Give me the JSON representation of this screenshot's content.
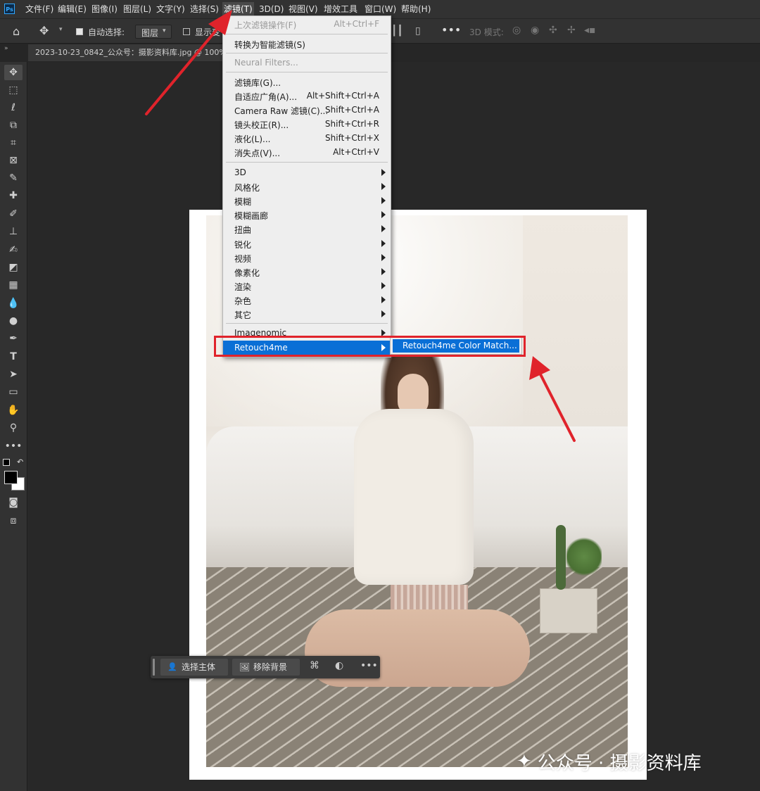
{
  "menubar": {
    "logo": "Ps",
    "items": [
      {
        "label": "文件(F)"
      },
      {
        "label": "编辑(E)"
      },
      {
        "label": "图像(I)"
      },
      {
        "label": "图层(L)"
      },
      {
        "label": "文字(Y)"
      },
      {
        "label": "选择(S)"
      },
      {
        "label": "滤镜(T)"
      },
      {
        "label": "3D(D)"
      },
      {
        "label": "视图(V)"
      },
      {
        "label": "增效工具"
      },
      {
        "label": "窗口(W)"
      },
      {
        "label": "帮助(H)"
      }
    ]
  },
  "options": {
    "auto_select_label": "自动选择:",
    "auto_select_value": "图层",
    "show_transform_label": "显示变",
    "mode_3d_label": "3D 模式:"
  },
  "document_tab": {
    "title": "2023-10-23_0842_公众号：摄影资料库.jpg @ 100%"
  },
  "filter_menu": {
    "items": [
      {
        "label": "上次滤镜操作(F)",
        "shortcut": "Alt+Ctrl+F",
        "disabled": true
      },
      {
        "label": "转换为智能滤镜(S)",
        "shortcut": ""
      },
      {
        "label": "Neural Filters...",
        "shortcut": "",
        "disabled": true
      },
      {
        "label": "滤镜库(G)...",
        "shortcut": ""
      },
      {
        "label": "自适应广角(A)...",
        "shortcut": "Alt+Shift+Ctrl+A"
      },
      {
        "label": "Camera Raw 滤镜(C)...",
        "shortcut": "Shift+Ctrl+A"
      },
      {
        "label": "镜头校正(R)...",
        "shortcut": "Shift+Ctrl+R"
      },
      {
        "label": "液化(L)...",
        "shortcut": "Shift+Ctrl+X"
      },
      {
        "label": "消失点(V)...",
        "shortcut": "Alt+Ctrl+V"
      },
      {
        "label": "3D",
        "submenu": true
      },
      {
        "label": "风格化",
        "submenu": true
      },
      {
        "label": "模糊",
        "submenu": true
      },
      {
        "label": "模糊画廊",
        "submenu": true
      },
      {
        "label": "扭曲",
        "submenu": true
      },
      {
        "label": "锐化",
        "submenu": true
      },
      {
        "label": "视频",
        "submenu": true
      },
      {
        "label": "像素化",
        "submenu": true
      },
      {
        "label": "渲染",
        "submenu": true
      },
      {
        "label": "杂色",
        "submenu": true
      },
      {
        "label": "其它",
        "submenu": true
      },
      {
        "label": "Imagenomic",
        "submenu": true
      },
      {
        "label": "Retouch4me",
        "submenu": true,
        "highlighted": true
      }
    ],
    "submenu_item": "Retouch4me Color Match..."
  },
  "context_bar": {
    "select_subject": "选择主体",
    "remove_background": "移除背景"
  },
  "watermark": "公众号 · 摄影资料库",
  "colors": {
    "highlight": "#0a6fd6",
    "annotation_red": "#e0232b"
  }
}
